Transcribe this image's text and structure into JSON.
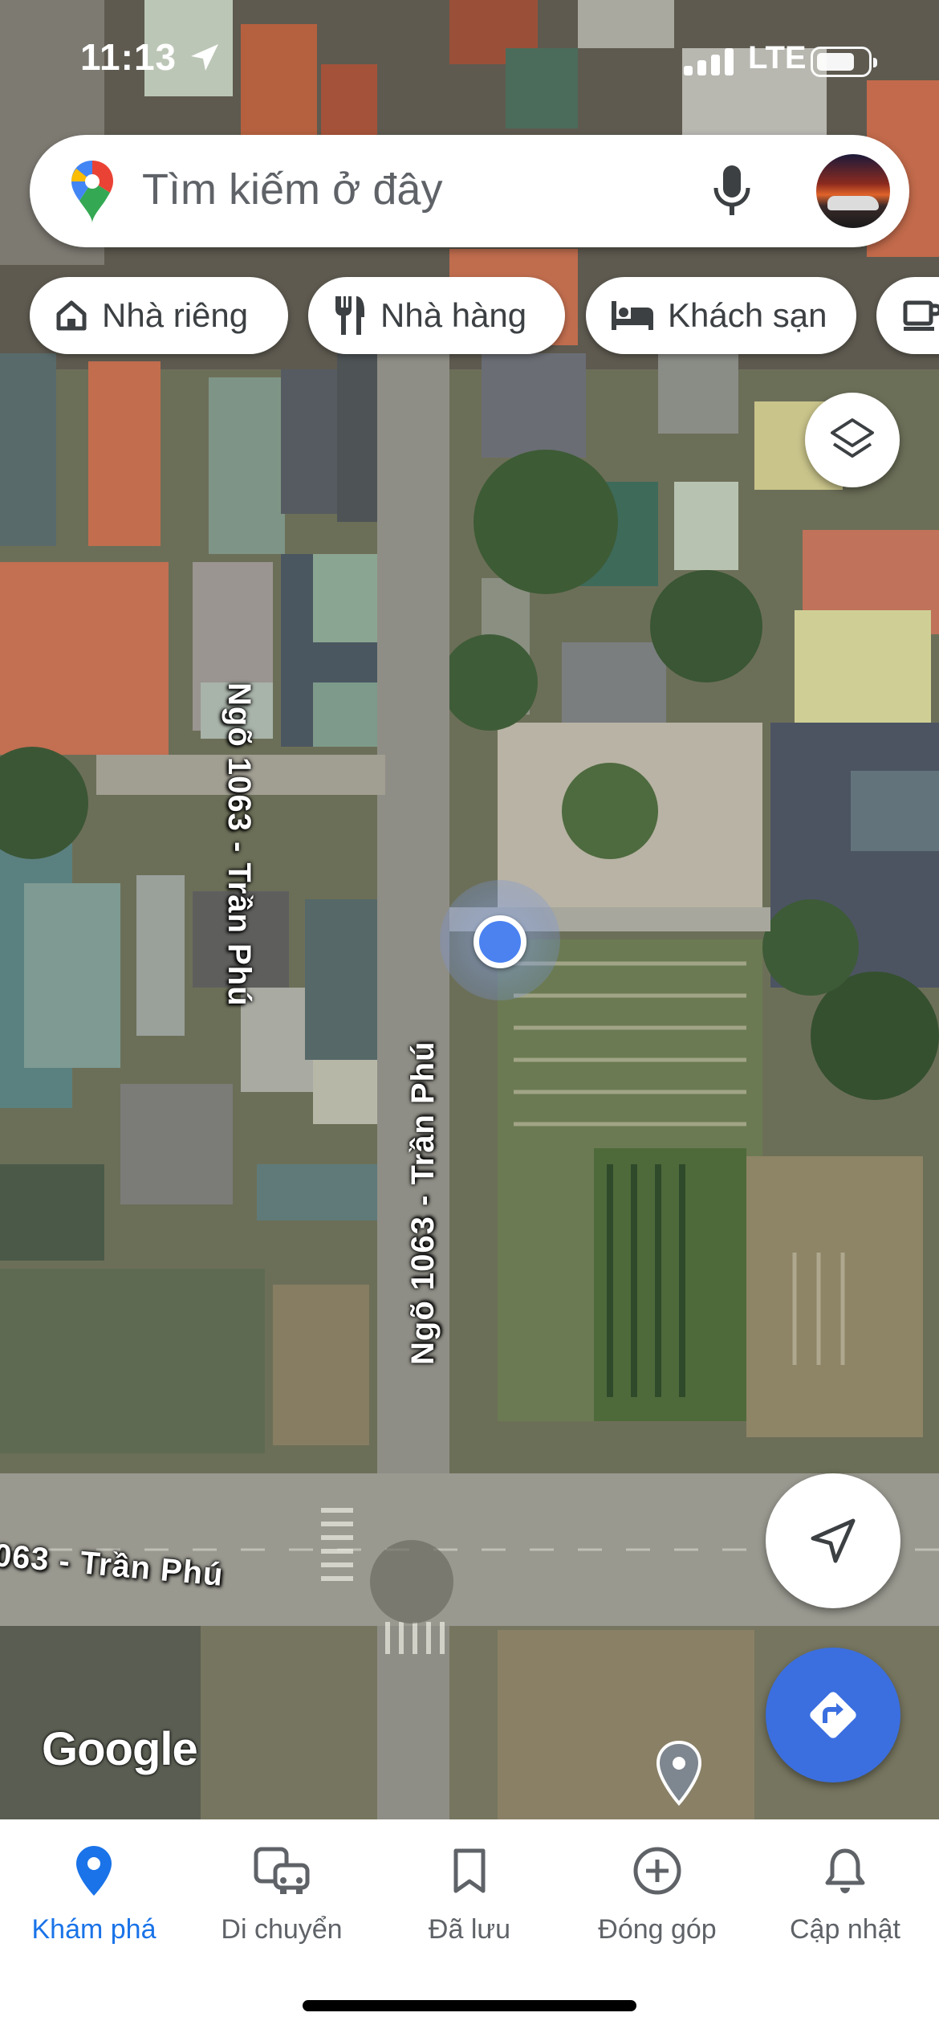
{
  "status_bar": {
    "time": "11:13",
    "network": "LTE"
  },
  "search": {
    "placeholder": "Tìm kiếm ở đây"
  },
  "chips": [
    {
      "label": "Nhà riêng",
      "icon": "home-icon"
    },
    {
      "label": "Nhà hàng",
      "icon": "restaurant-icon"
    },
    {
      "label": "Khách sạn",
      "icon": "hotel-icon"
    },
    {
      "label": "",
      "icon": "coffee-icon"
    }
  ],
  "map": {
    "road_labels": [
      "Ngõ 1063 - Trần Phú",
      "Ngõ 1063 - Trần Phú",
      "063 - Trần Phú"
    ],
    "attribution": "Google"
  },
  "nav": [
    {
      "label": "Khám phá",
      "icon": "explore-pin-icon",
      "active": true
    },
    {
      "label": "Di chuyển",
      "icon": "commute-icon",
      "active": false
    },
    {
      "label": "Đã lưu",
      "icon": "bookmark-icon",
      "active": false
    },
    {
      "label": "Đóng góp",
      "icon": "add-circle-icon",
      "active": false
    },
    {
      "label": "Cập nhật",
      "icon": "bell-icon",
      "active": false
    }
  ],
  "colors": {
    "accent": "#1a73e8",
    "fab_blue": "#3b6fe0",
    "location_dot": "#4b82f0"
  }
}
